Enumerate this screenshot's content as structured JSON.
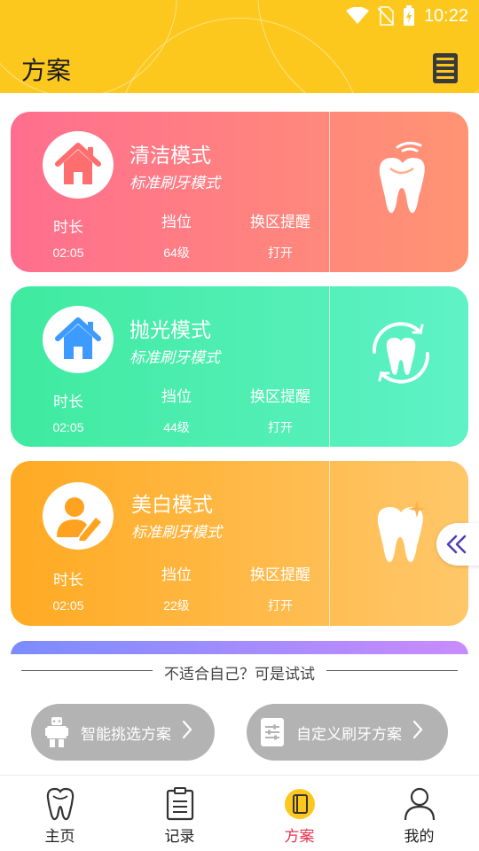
{
  "status_bar": {
    "time": "10:22"
  },
  "header": {
    "title": "方案",
    "menu_icon": "menu-icon"
  },
  "plans": [
    {
      "title": "清洁模式",
      "subtitle": "标准刷牙模式",
      "icon": "house-icon",
      "tooth_icon": "tooth-sparkle-icon",
      "duration_label": "时长",
      "duration_value": "02:05",
      "level_label": "挡位",
      "level_value": "64级",
      "zone_label": "换区提醒",
      "zone_value": "打开",
      "colors": {
        "from": "#FF6E8E",
        "to": "#FF9473",
        "avatar": "#FF6E6E"
      }
    },
    {
      "title": "抛光模式",
      "subtitle": "标准刷牙模式",
      "icon": "house-icon",
      "tooth_icon": "tooth-circle-icon",
      "duration_label": "时长",
      "duration_value": "02:05",
      "level_label": "挡位",
      "level_value": "44级",
      "zone_label": "换区提醒",
      "zone_value": "打开",
      "colors": {
        "from": "#3FEA9F",
        "to": "#5FF2C6",
        "avatar": "#3D9BFF"
      }
    },
    {
      "title": "美白模式",
      "subtitle": "标准刷牙模式",
      "icon": "user-edit-icon",
      "tooth_icon": "tooth-star-icon",
      "duration_label": "时长",
      "duration_value": "02:05",
      "level_label": "挡位",
      "level_value": "22级",
      "zone_label": "换区提醒",
      "zone_value": "打开",
      "colors": {
        "from": "#FFAA22",
        "to": "#FFC76A",
        "avatar": "#FFA21F"
      }
    }
  ],
  "suggestion": {
    "text": "不适合自己？可是试试",
    "smart_button": "智能挑选方案",
    "custom_button": "自定义刷牙方案"
  },
  "nav": {
    "items": [
      {
        "label": "主页",
        "icon": "tooth-outline-icon"
      },
      {
        "label": "记录",
        "icon": "clipboard-icon"
      },
      {
        "label": "方案",
        "icon": "notebook-icon",
        "active": true
      },
      {
        "label": "我的",
        "icon": "person-icon"
      }
    ],
    "active_color": "#E8344D"
  },
  "colors": {
    "header": "#FDC81E",
    "pill": "#B3B3B3"
  }
}
